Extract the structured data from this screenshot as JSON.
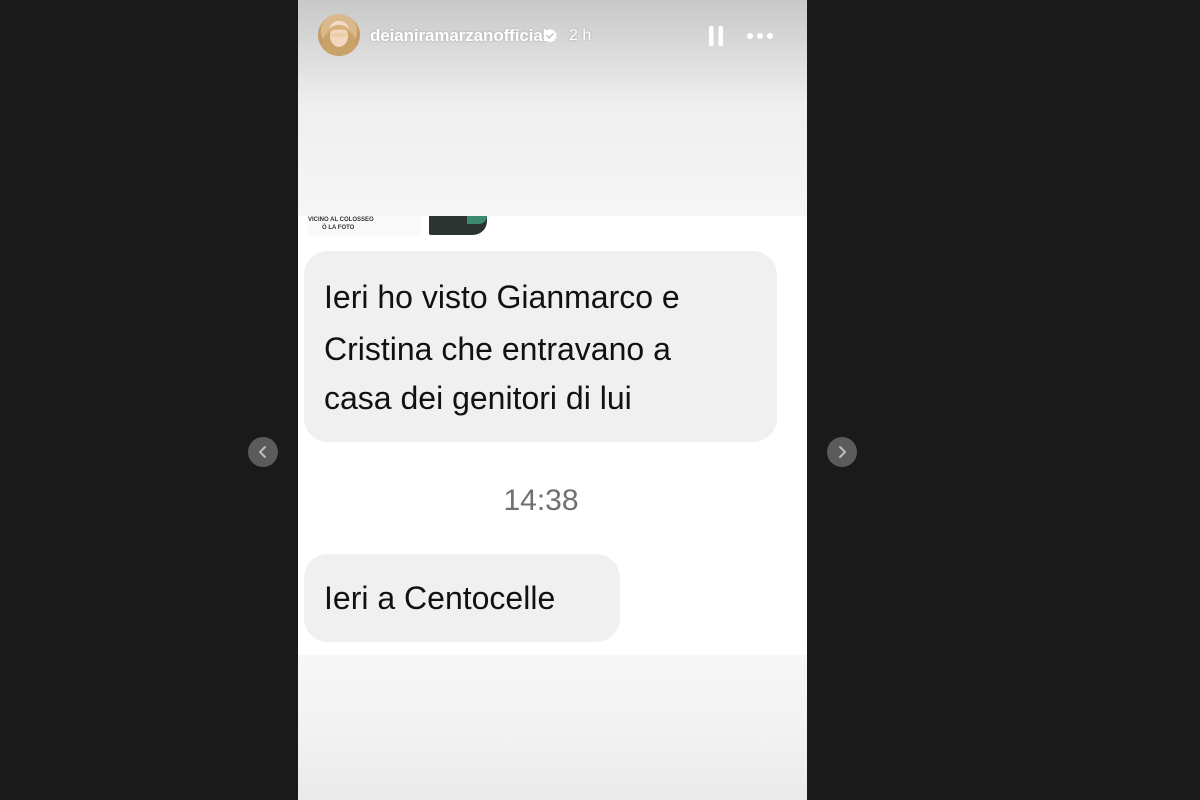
{
  "story": {
    "username": "deianiramarzanofficial",
    "time_ago": "2 h",
    "verified_icon": "verified-badge-icon",
    "pause_icon": "pause-icon",
    "more_icon": "more-icon"
  },
  "thumbnail": {
    "caption_line_1": "VICINO AL COLOSSEO",
    "caption_line_2": "Ò LA FOTO"
  },
  "chat": {
    "message_1_lines": [
      "Ieri ho visto Gianmarco e",
      "Cristina che entravano a",
      "casa dei genitori di lui"
    ],
    "timestamp": "14:38",
    "message_2": "Ieri a Centocelle"
  },
  "navigation": {
    "prev_icon": "chevron-left-icon",
    "next_icon": "chevron-right-icon"
  },
  "colors": {
    "backdrop": "#1a1a1a",
    "bubble": "#f0f0f0",
    "timestamp_text": "#707070",
    "nav_button": "#5b5b5b"
  }
}
